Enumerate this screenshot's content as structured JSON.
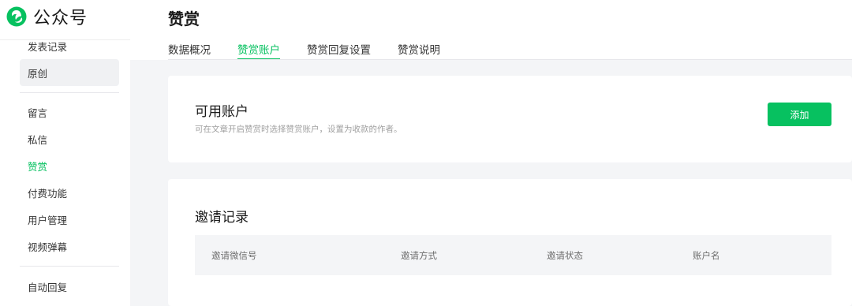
{
  "brand": {
    "name": "公众号",
    "color": "#07c160",
    "icon": "wechat-oa-logo-icon"
  },
  "sidebar": {
    "items": [
      {
        "label": "发表记录"
      },
      {
        "label": "原创"
      },
      {
        "label": "留言"
      },
      {
        "label": "私信"
      },
      {
        "label": "赞赏"
      },
      {
        "label": "付费功能"
      },
      {
        "label": "用户管理"
      },
      {
        "label": "视频弹幕"
      },
      {
        "label": "自动回复"
      }
    ]
  },
  "header": {
    "title": "赞赏",
    "tabs": [
      {
        "label": "数据概况"
      },
      {
        "label": "赞赏账户"
      },
      {
        "label": "赞赏回复设置"
      },
      {
        "label": "赞赏说明"
      }
    ],
    "active_tab": "赞赏账户"
  },
  "accounts_card": {
    "title": "可用账户",
    "description": "可在文章开启赞赏时选择赞赏账户，设置为收款的作者。",
    "add_button": "添加"
  },
  "invite_card": {
    "title": "邀请记录",
    "columns": [
      "邀请微信号",
      "邀请方式",
      "邀请状态",
      "账户名"
    ]
  }
}
